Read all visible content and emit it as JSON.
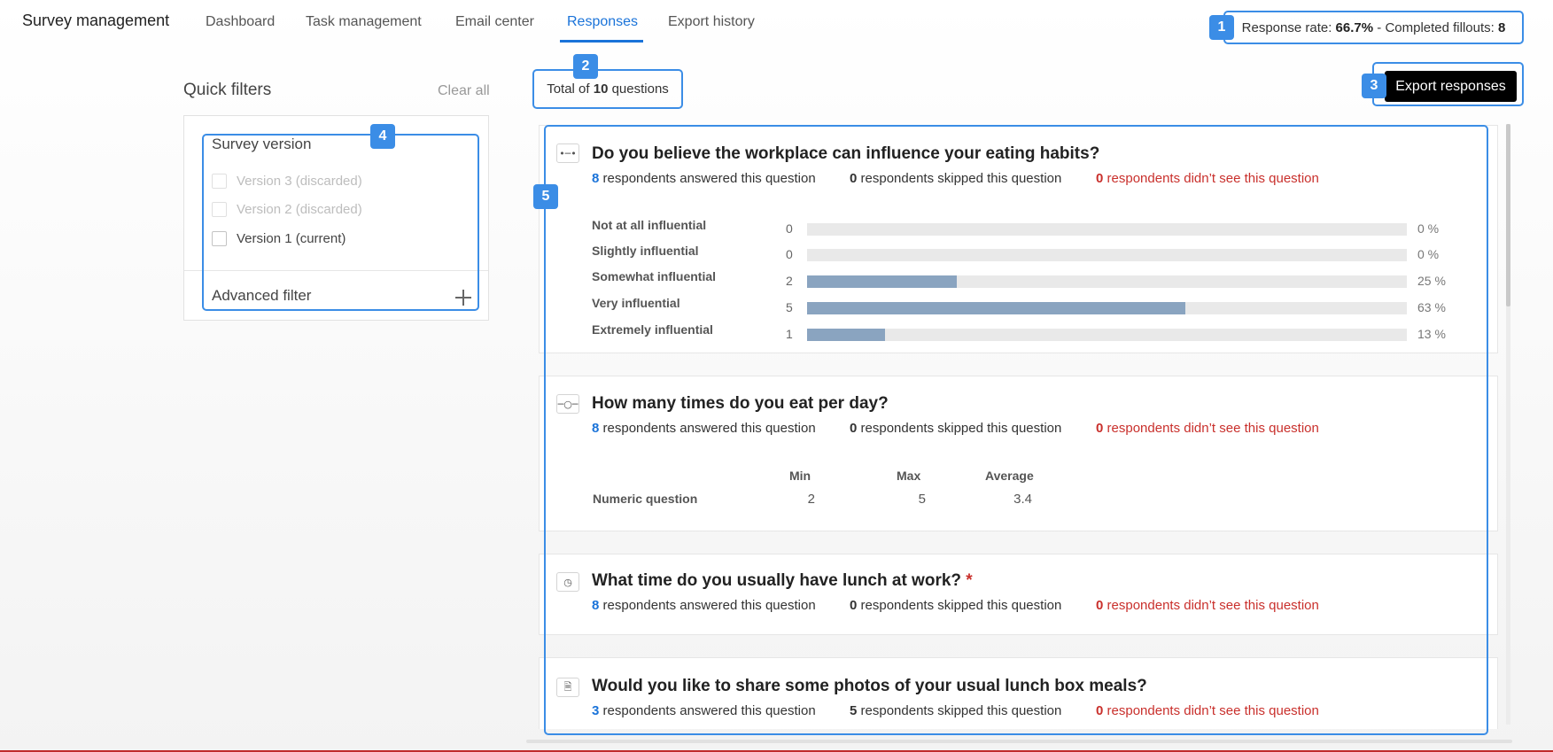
{
  "app_title": "Survey management",
  "nav": {
    "tabs": [
      {
        "label": "Dashboard"
      },
      {
        "label": "Task management"
      },
      {
        "label": "Email center"
      },
      {
        "label": "Responses"
      },
      {
        "label": "Export history"
      }
    ],
    "active_tab": "Responses"
  },
  "header_stats": {
    "response_rate_label": "Response rate:",
    "response_rate_value": "66.7%",
    "separator": " - ",
    "completed_label": "Completed fillouts:",
    "completed_value": "8"
  },
  "markers": {
    "m1": "1",
    "m2": "2",
    "m3": "3",
    "m4": "4",
    "m5": "5"
  },
  "quick_filters": {
    "title": "Quick filters",
    "clear_all": "Clear all",
    "survey_version": {
      "title": "Survey version",
      "options": [
        {
          "label": "Version 3 (discarded)",
          "disabled": true,
          "checked": false
        },
        {
          "label": "Version 2 (discarded)",
          "disabled": true,
          "checked": false
        },
        {
          "label": "Version 1 (current)",
          "disabled": false,
          "checked": false
        }
      ]
    },
    "advanced_filter": "Advanced filter"
  },
  "main": {
    "total_prefix": "Total of",
    "total_value": "10",
    "total_suffix": "questions",
    "export_button": "Export responses"
  },
  "stat_texts": {
    "answered": "respondents answered this question",
    "skipped": "respondents skipped this question",
    "not_seen": "respondents didn’t see this question"
  },
  "questions": [
    {
      "icon": "likert-scale-icon",
      "title": "Do you believe the workplace can influence your eating habits?",
      "answered": "8",
      "skipped": "0",
      "not_seen": "0",
      "options": [
        {
          "label": "Not at all influential",
          "count": "0",
          "pct": "0 %",
          "fraction": 0
        },
        {
          "label": "Slightly influential",
          "count": "0",
          "pct": "0 %",
          "fraction": 0
        },
        {
          "label": "Somewhat influential",
          "count": "2",
          "pct": "25 %",
          "fraction": 0.25
        },
        {
          "label": "Very influential",
          "count": "5",
          "pct": "63 %",
          "fraction": 0.63
        },
        {
          "label": "Extremely influential",
          "count": "1",
          "pct": "13 %",
          "fraction": 0.13
        }
      ]
    },
    {
      "icon": "numeric-slider-icon",
      "title": "How many times do you eat per day?",
      "answered": "8",
      "skipped": "0",
      "not_seen": "0",
      "numeric": {
        "headers": {
          "min": "Min",
          "max": "Max",
          "avg": "Average"
        },
        "row_label": "Numeric question",
        "min": "2",
        "max": "5",
        "avg": "3.4"
      }
    },
    {
      "icon": "clock-icon",
      "title": "What time do you usually have lunch at work?",
      "required_mark": "*",
      "answered": "8",
      "skipped": "0",
      "not_seen": "0"
    },
    {
      "icon": "file-upload-icon",
      "title": "Would you like to share some photos of your usual lunch box meals?",
      "answered": "3",
      "skipped": "5",
      "not_seen": "0"
    }
  ],
  "colors": {
    "accent": "#1a73d9",
    "highlight": "#3b8de6",
    "bar_fill": "#8aa4c0",
    "danger": "#c9302c"
  }
}
